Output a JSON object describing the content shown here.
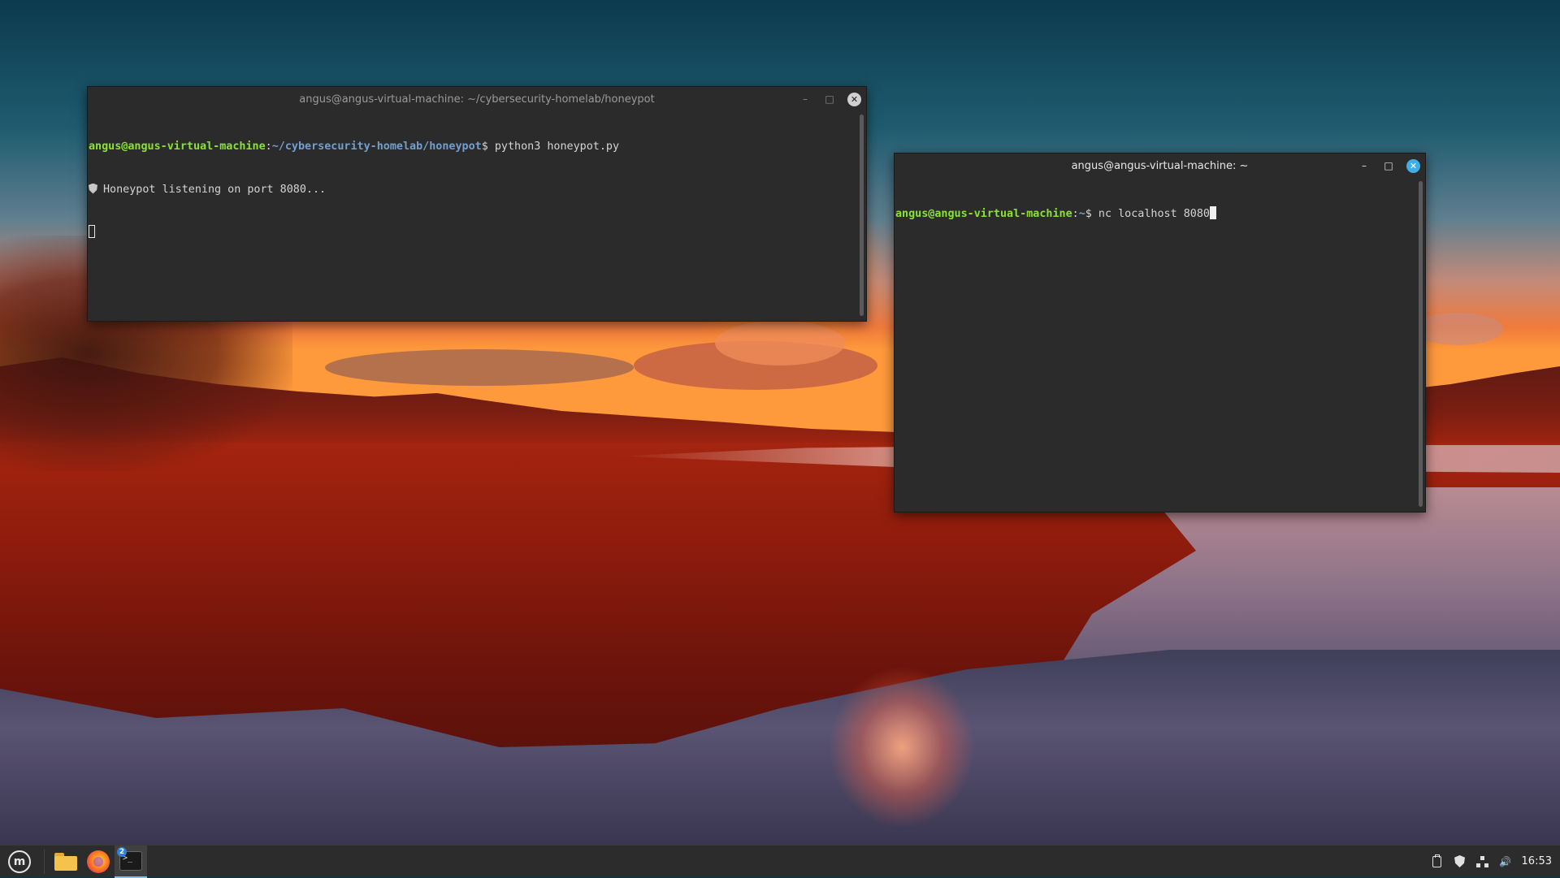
{
  "theme": {
    "accent": "#3daee9",
    "prompt_green": "#8ae234",
    "prompt_blue": "#729fcf",
    "terminal_bg": "#2b2b2b",
    "title_active": "#e8e8e8",
    "title_inactive": "#9a9a9a"
  },
  "window_left": {
    "title": "angus@angus-virtual-machine: ~/cybersecurity-homelab/honeypot",
    "active": false,
    "lines": [
      {
        "user": "angus@angus-virtual-machine",
        "sep": ":",
        "path": "~/cybersecurity-homelab/honeypot",
        "symbol": "$",
        "command": " python3 honeypot.py"
      },
      {
        "icon": "shield-icon",
        "text": "Honeypot listening on port 8080..."
      }
    ]
  },
  "window_right": {
    "title": "angus@angus-virtual-machine: ~",
    "active": true,
    "lines": [
      {
        "user": "angus@angus-virtual-machine",
        "sep": ":",
        "path": "~",
        "symbol": "$",
        "command": " nc localhost 8080"
      }
    ]
  },
  "window_controls": {
    "minimize": "–",
    "maximize": "□",
    "close": "✕"
  },
  "taskbar": {
    "menu_icon": "linux-mint-logo",
    "menu_letter": "m",
    "launchers": [
      "folder-icon",
      "firefox-icon",
      "terminal-icon"
    ],
    "terminal_window_count": "2",
    "terminal_prompt_glyph": ">_",
    "tray_icons": [
      "clipboard-icon",
      "shield-icon",
      "network-icon",
      "volume-icon"
    ],
    "volume_glyph": "🔊",
    "clock": "16:53"
  }
}
